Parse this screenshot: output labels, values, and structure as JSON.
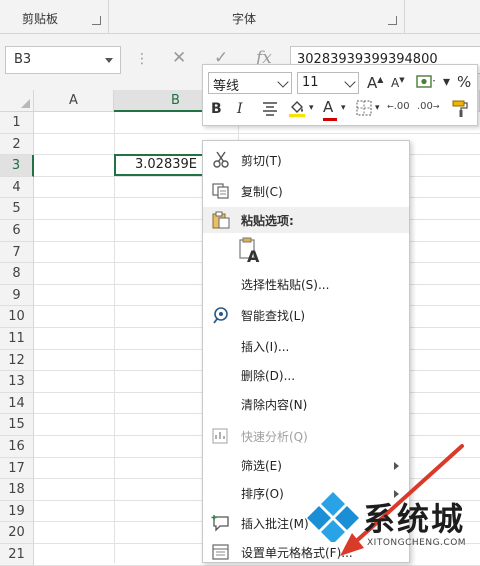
{
  "ribbon": {
    "clipboard_label": "剪贴板",
    "font_label": "字体"
  },
  "formula_bar": {
    "name_box": "B3",
    "dots": "⋮",
    "cancel": "✕",
    "confirm": "✓",
    "fx": "fx",
    "formula_value": "30283939399394800"
  },
  "grid": {
    "columns": [
      "A",
      "B"
    ],
    "rows": [
      "1",
      "2",
      "3",
      "4",
      "5",
      "6",
      "7",
      "8",
      "9",
      "10",
      "11",
      "12",
      "13",
      "14",
      "15",
      "16",
      "17",
      "18",
      "19",
      "20",
      "21"
    ],
    "active_cell_value": "3.02839E"
  },
  "mini_toolbar": {
    "font_name": "等线",
    "font_size": "11",
    "increase_font": "A",
    "decrease_font": "A",
    "percent": "%",
    "bold": "B",
    "italic": "I",
    "font_color_letter": "A",
    "increase_decimal": ".00",
    "decrease_decimal": ".00"
  },
  "context_menu": {
    "items": [
      {
        "label": "剪切(T)",
        "icon": "scissors-icon"
      },
      {
        "label": "复制(C)",
        "icon": "copy-icon"
      },
      {
        "label": "粘贴选项:",
        "icon": "paste-icon"
      },
      {
        "label": "选择性粘贴(S)...",
        "icon": ""
      },
      {
        "label": "智能查找(L)",
        "icon": "smart-lookup-icon"
      },
      {
        "label": "插入(I)...",
        "icon": ""
      },
      {
        "label": "删除(D)...",
        "icon": ""
      },
      {
        "label": "清除内容(N)",
        "icon": ""
      },
      {
        "label": "快速分析(Q)",
        "icon": "quick-analysis-icon"
      },
      {
        "label": "筛选(E)",
        "icon": ""
      },
      {
        "label": "排序(O)",
        "icon": ""
      },
      {
        "label": "插入批注(M)",
        "icon": "comment-icon"
      },
      {
        "label": "设置单元格格式(F)...",
        "icon": "format-cells-icon"
      }
    ],
    "paste_option_letter": "A"
  },
  "watermark": {
    "title": "系统城",
    "url": "XITONGCHENG.COM"
  },
  "colors": {
    "accent_green": "#217346",
    "arrow_red": "#d93a2a",
    "logo_blue": "#1a8fd6"
  }
}
